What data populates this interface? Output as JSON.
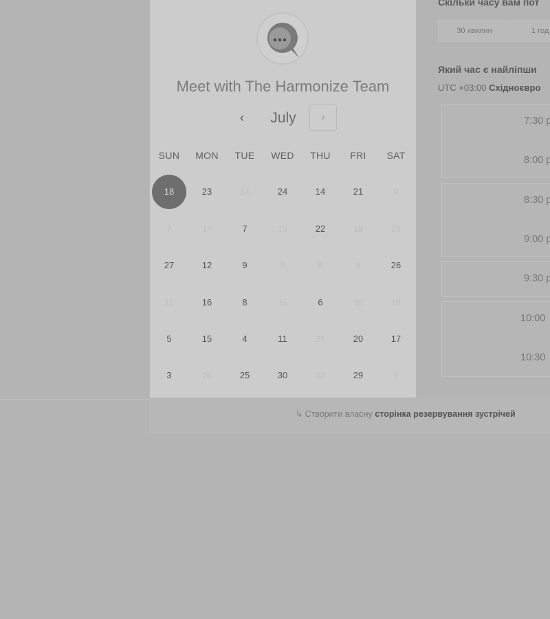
{
  "calendar": {
    "title": "Meet with The Harmonize Team",
    "month": "July",
    "prev_label": "‹",
    "next_label": "›",
    "logo_icon": "chat-bubble-icon",
    "weekdays": [
      "SUN",
      "MON",
      "TUE",
      "WED",
      "THU",
      "FRI",
      "SAT"
    ],
    "selected_color": "#6e6e6e",
    "rows": [
      [
        {
          "d": "18",
          "s": "selected"
        },
        {
          "d": "23",
          "s": "active"
        },
        {
          "d": "14",
          "s": "muted"
        },
        {
          "d": "24",
          "s": "active"
        },
        {
          "d": "14",
          "s": "active"
        },
        {
          "d": "21",
          "s": "active"
        },
        {
          "d": "9",
          "s": "muted"
        }
      ],
      [
        {
          "d": "7",
          "s": "muted"
        },
        {
          "d": "14",
          "s": "muted"
        },
        {
          "d": "7",
          "s": "active"
        },
        {
          "d": "13",
          "s": "muted"
        },
        {
          "d": "22",
          "s": "active"
        },
        {
          "d": "19",
          "s": "muted"
        },
        {
          "d": "24",
          "s": "muted"
        }
      ],
      [
        {
          "d": "27",
          "s": "active"
        },
        {
          "d": "12",
          "s": "active"
        },
        {
          "d": "9",
          "s": "active"
        },
        {
          "d": "7",
          "s": "muted"
        },
        {
          "d": "8",
          "s": "muted"
        },
        {
          "d": "9",
          "s": "muted"
        },
        {
          "d": "26",
          "s": "active"
        }
      ],
      [
        {
          "d": "12",
          "s": "muted"
        },
        {
          "d": "16",
          "s": "active"
        },
        {
          "d": "8",
          "s": "active"
        },
        {
          "d": "15",
          "s": "muted"
        },
        {
          "d": "6",
          "s": "active"
        },
        {
          "d": "30",
          "s": "muted"
        },
        {
          "d": "18",
          "s": "muted"
        }
      ],
      [
        {
          "d": "5",
          "s": "active"
        },
        {
          "d": "15",
          "s": "active"
        },
        {
          "d": "4",
          "s": "active"
        },
        {
          "d": "11",
          "s": "active"
        },
        {
          "d": "27",
          "s": "muted"
        },
        {
          "d": "20",
          "s": "active"
        },
        {
          "d": "17",
          "s": "active"
        }
      ],
      [
        {
          "d": "3",
          "s": "active"
        },
        {
          "d": "26",
          "s": "muted"
        },
        {
          "d": "25",
          "s": "active"
        },
        {
          "d": "30",
          "s": "active"
        },
        {
          "d": "12",
          "s": "muted"
        },
        {
          "d": "29",
          "s": "active"
        },
        {
          "d": "7",
          "s": "muted"
        }
      ]
    ]
  },
  "booking": {
    "duration_question": "Скільки часу вам пот",
    "durations": [
      "30 хвилин",
      "1 год"
    ],
    "time_question": "Який час є найліпши",
    "timezone_prefix": "UTC +03:00",
    "timezone_name": "Східноєвро",
    "slots": [
      "7:30 р",
      "8:00 р",
      "8:30 р",
      "9:00 р",
      "9:30 р",
      "10:00",
      "10:30"
    ]
  },
  "footer": {
    "arrow": "↳",
    "link_prefix": "Створити власну",
    "link_bold": "сторінка резервування зустрічей"
  }
}
